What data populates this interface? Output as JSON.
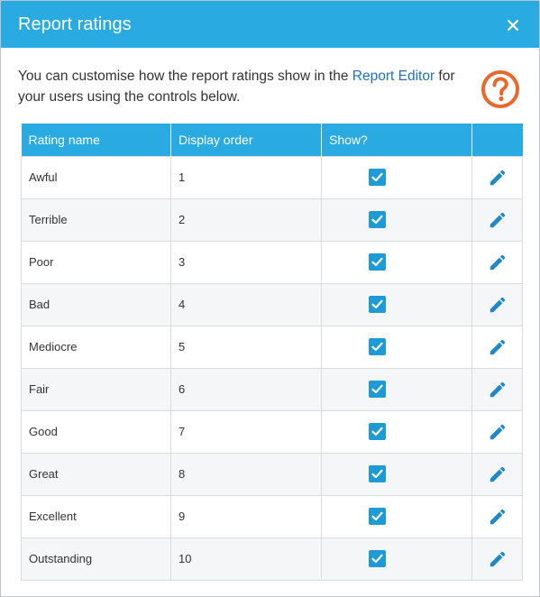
{
  "dialog": {
    "title": "Report ratings",
    "close_icon": "close-icon",
    "help_icon": "help-icon"
  },
  "intro": {
    "text_before": "You can customise how the report ratings show in the ",
    "link": "Report Editor",
    "text_after": " for your users using the controls below."
  },
  "table": {
    "headers": [
      "Rating name",
      "Display order",
      "Show?",
      ""
    ],
    "rows": [
      {
        "name": "Awful",
        "order": "1",
        "show": true
      },
      {
        "name": "Terrible",
        "order": "2",
        "show": true
      },
      {
        "name": "Poor",
        "order": "3",
        "show": true
      },
      {
        "name": "Bad",
        "order": "4",
        "show": true
      },
      {
        "name": "Mediocre",
        "order": "5",
        "show": true
      },
      {
        "name": "Fair",
        "order": "6",
        "show": true
      },
      {
        "name": "Good",
        "order": "7",
        "show": true
      },
      {
        "name": "Great",
        "order": "8",
        "show": true
      },
      {
        "name": "Excellent",
        "order": "9",
        "show": true
      },
      {
        "name": "Outstanding",
        "order": "10",
        "show": true
      }
    ]
  },
  "colors": {
    "header": "#29abe2",
    "checkbox": "#1e9ad6",
    "edit_icon": "#1e88c8",
    "help_icon": "#e86a2a",
    "link": "#1f6fc1"
  }
}
